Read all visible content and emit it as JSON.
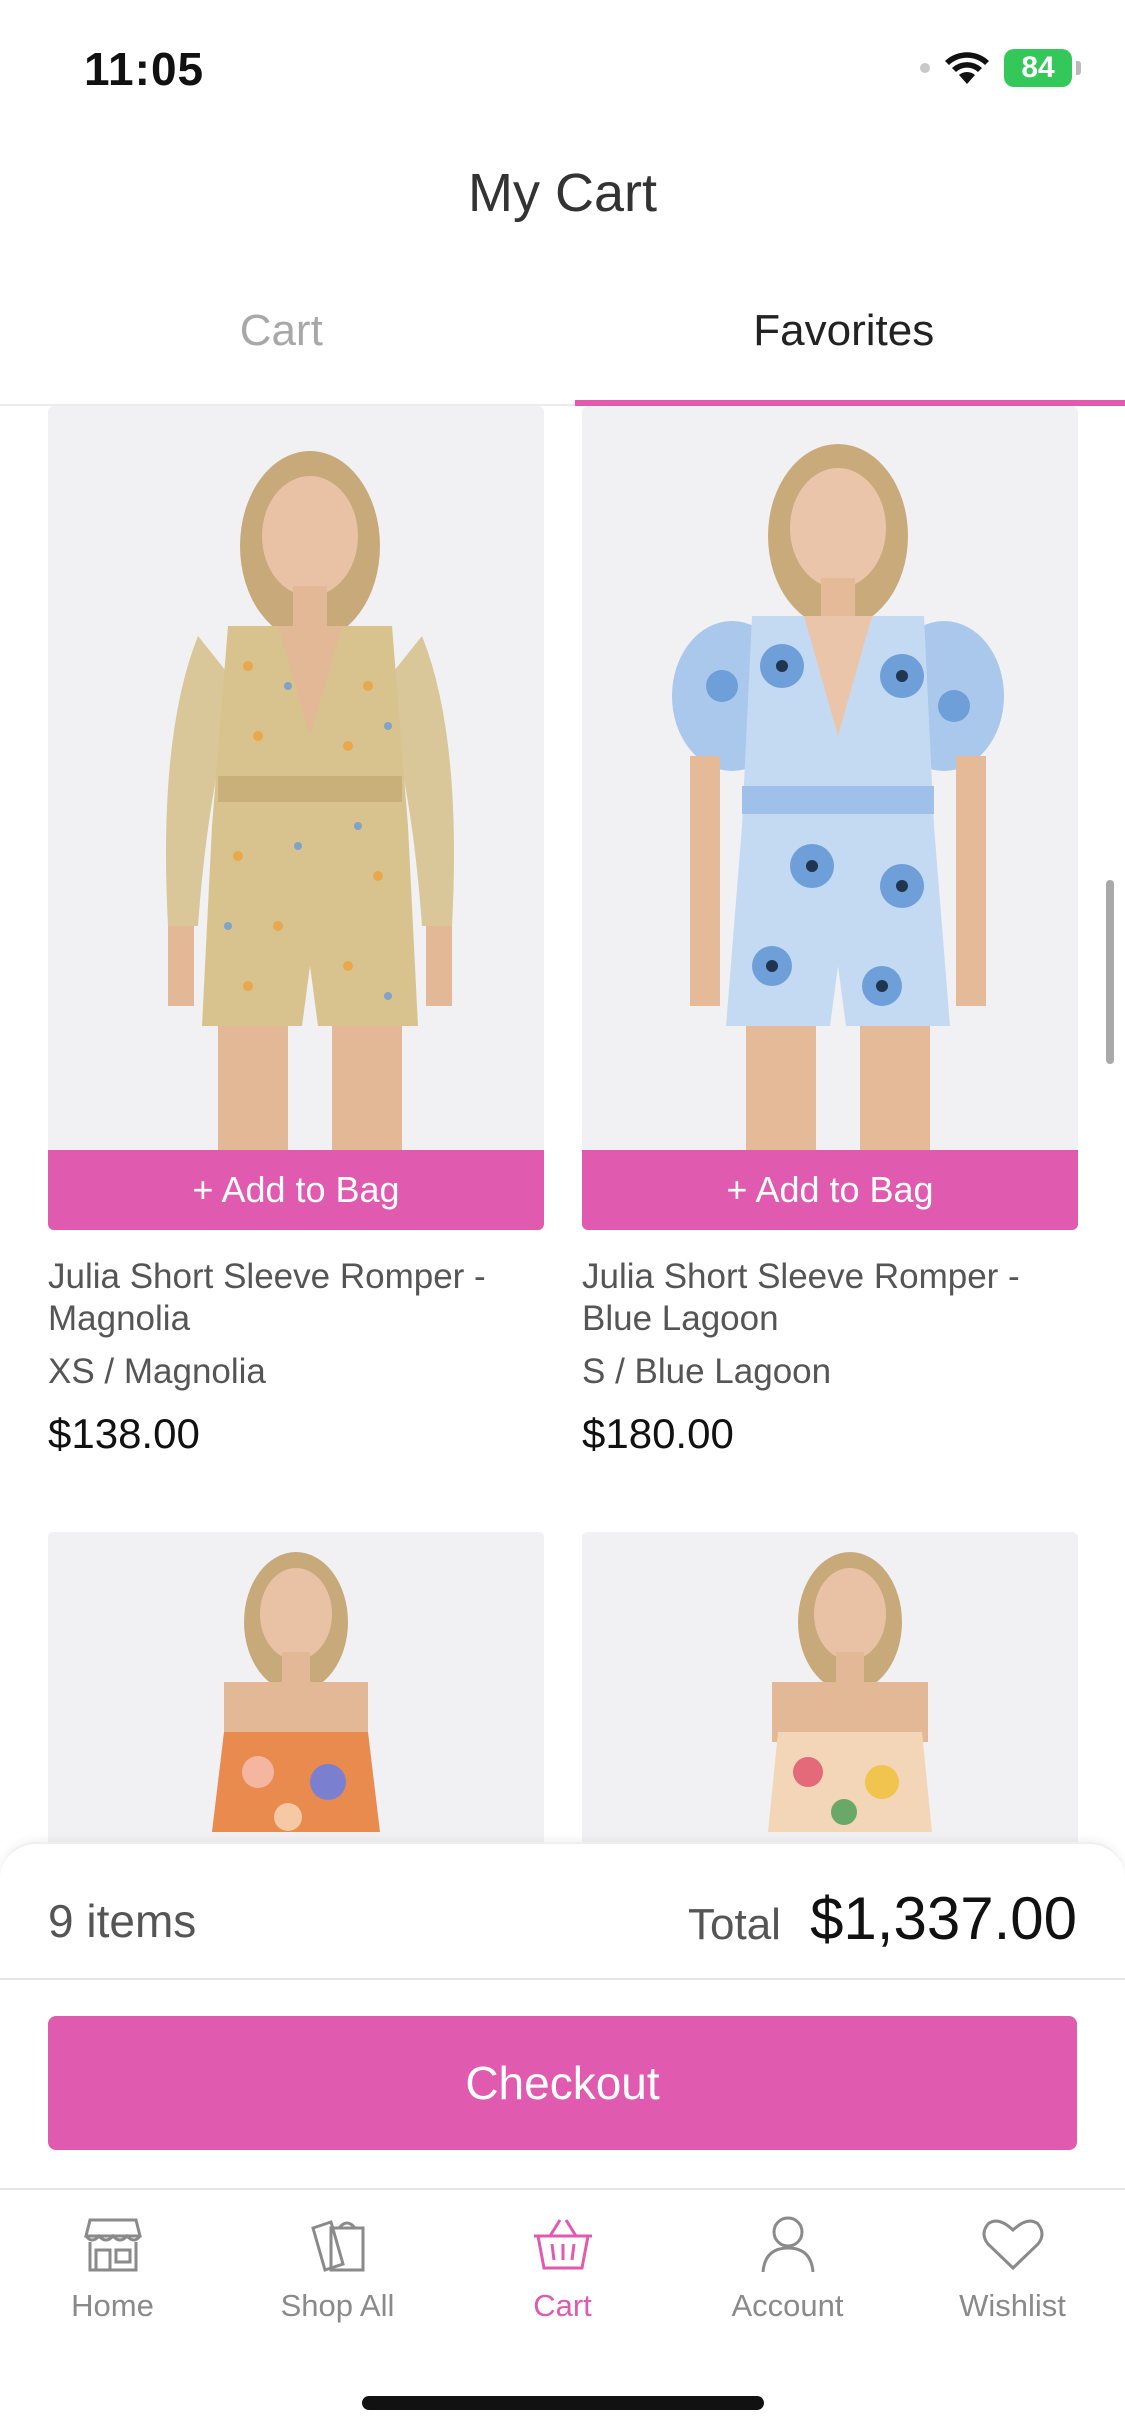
{
  "status_bar": {
    "time": "11:05",
    "battery": "84"
  },
  "header": {
    "title": "My Cart"
  },
  "tabs": [
    {
      "label": "Cart",
      "active": false
    },
    {
      "label": "Favorites",
      "active": true
    }
  ],
  "products": [
    {
      "add_label": "+ Add to Bag",
      "name": "Julia Short Sleeve Romper - Magnolia",
      "variant": "XS / Magnolia",
      "price": "$138.00"
    },
    {
      "add_label": "+ Add to Bag",
      "name": "Julia Short Sleeve Romper - Blue Lagoon",
      "variant": "S / Blue Lagoon",
      "price": "$180.00"
    }
  ],
  "summary": {
    "items": "9 items",
    "total_label": "Total",
    "total_value": "$1,337.00",
    "checkout_label": "Checkout"
  },
  "tabbar": [
    {
      "label": "Home",
      "icon": "storefront-icon"
    },
    {
      "label": "Shop All",
      "icon": "bags-icon"
    },
    {
      "label": "Cart",
      "icon": "basket-icon",
      "active": true
    },
    {
      "label": "Account",
      "icon": "person-icon"
    },
    {
      "label": "Wishlist",
      "icon": "heart-icon"
    }
  ],
  "colors": {
    "accent": "#e05aaf",
    "battery": "#34c759"
  }
}
